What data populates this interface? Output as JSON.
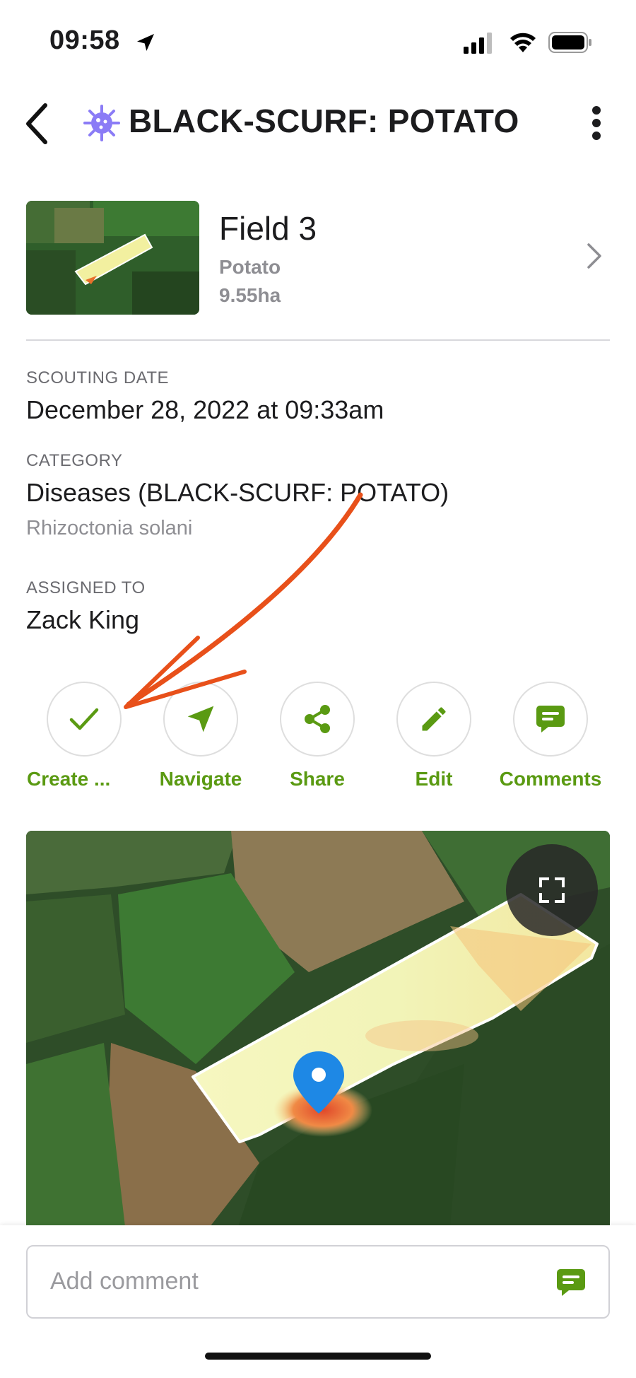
{
  "status_bar": {
    "time": "09:58"
  },
  "header": {
    "title": "BLACK-SCURF: POTATO"
  },
  "field": {
    "name": "Field 3",
    "crop": "Potato",
    "area": "9.55ha"
  },
  "scouting": {
    "label": "SCOUTING DATE",
    "value": "December 28, 2022 at 09:33am"
  },
  "category": {
    "label": "CATEGORY",
    "value": "Diseases (BLACK-SCURF: POTATO)",
    "subvalue": "Rhizoctonia solani"
  },
  "assigned": {
    "label": "ASSIGNED TO",
    "value": "Zack King"
  },
  "actions": [
    {
      "label": "Create ...",
      "icon": "check-icon"
    },
    {
      "label": "Navigate",
      "icon": "navigate-icon"
    },
    {
      "label": "Share",
      "icon": "share-icon"
    },
    {
      "label": "Edit",
      "icon": "pencil-icon"
    },
    {
      "label": "Comments",
      "icon": "comment-icon"
    }
  ],
  "comment": {
    "placeholder": "Add comment"
  },
  "colors": {
    "accent_green": "#5a9a12",
    "annotation_arrow": "#e8501a",
    "virus_purple": "#8b7cf6",
    "pin_blue": "#1e88e5"
  }
}
